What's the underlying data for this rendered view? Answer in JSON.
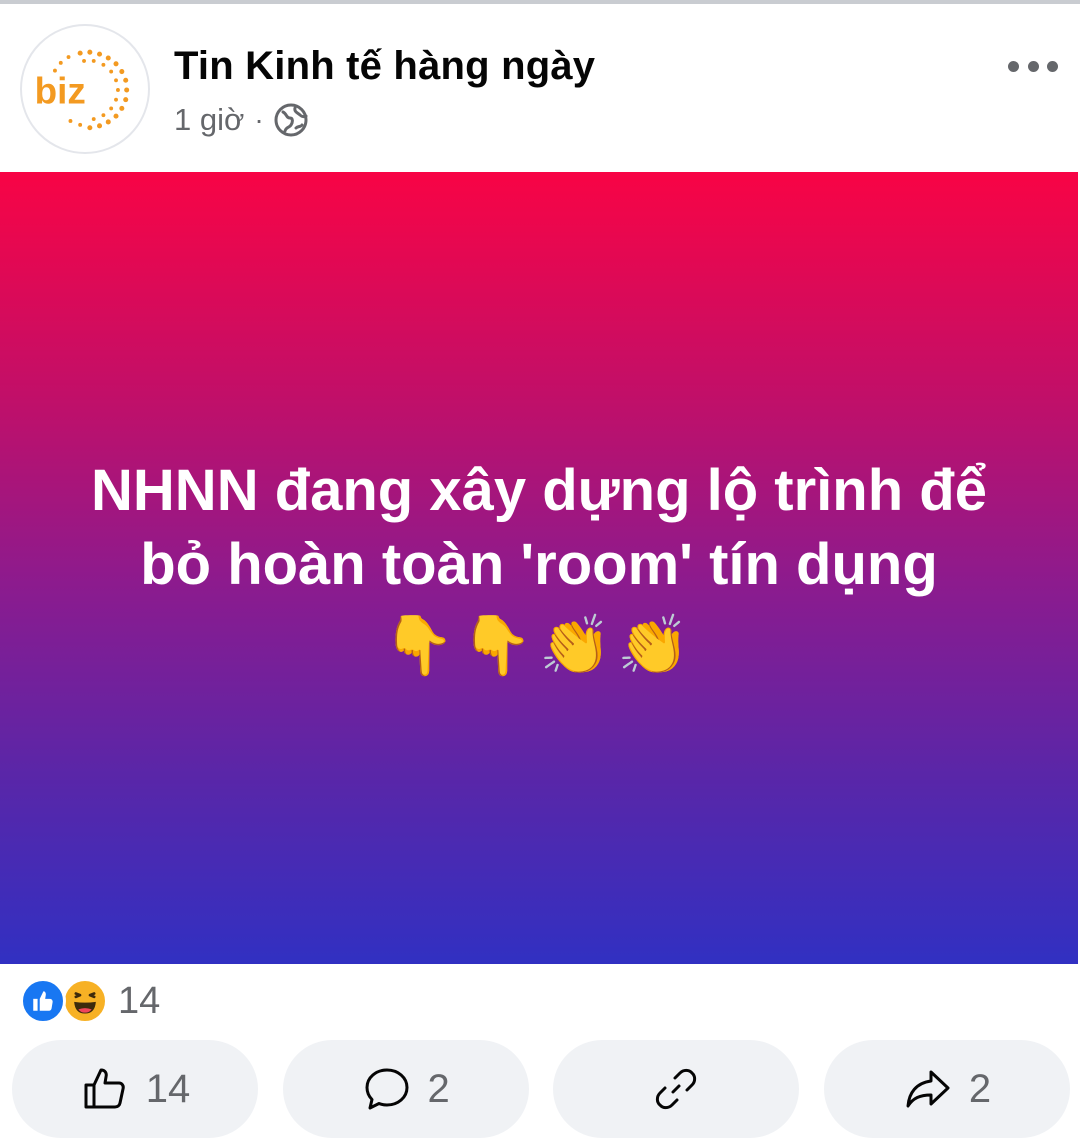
{
  "post": {
    "page_name": "Tin Kinh tế hàng ngày",
    "time_ago": "1 giờ",
    "separator": "·",
    "privacy_icon": "globe-icon",
    "avatar_logo_text": "biz",
    "text_line1": "NHNN đang xây dựng lộ trình để",
    "text_line2": "bỏ hoàn toàn 'room' tín dụng",
    "emoji_line": "👇👇👏👏",
    "background_gradient": [
      "#f80445",
      "#8c1b8e",
      "#3130c2"
    ]
  },
  "reactions": {
    "icons": [
      "like-icon",
      "haha-icon"
    ],
    "count": "14"
  },
  "actions": {
    "like_count": "14",
    "comment_count": "2",
    "share_count": "2"
  },
  "colors": {
    "like_blue": "#1877f2",
    "haha_yellow": "#f7b125",
    "muted_text": "#65676b",
    "button_bg": "#f0f2f5",
    "logo_orange": "#f39a21"
  }
}
